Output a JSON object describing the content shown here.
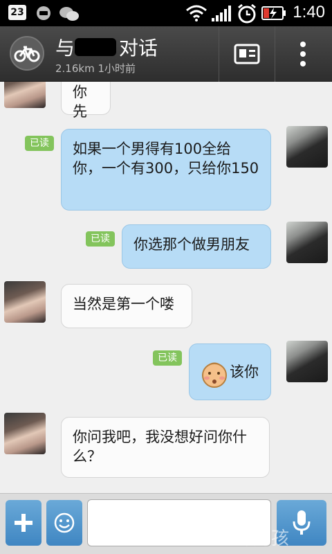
{
  "status_bar": {
    "date": "23",
    "time": "1:40",
    "icons": [
      "calendar-icon",
      "chat-notification-icon",
      "wechat-icon",
      "wifi-icon",
      "signal-icon",
      "alarm-icon",
      "battery-charging-icon"
    ]
  },
  "header": {
    "title": "与",
    "title_tail": "对话",
    "subtitle": "2.16km 1小时前",
    "icons": [
      "bicycle-icon",
      "profile-card-icon",
      "more-vert-icon"
    ]
  },
  "messages": [
    {
      "side": "in",
      "text": "你先"
    },
    {
      "side": "out",
      "text": "如果一个男得有100全给你，一个有300，只给你150",
      "read": "已读"
    },
    {
      "side": "out",
      "text": "你选那个做男朋友",
      "read": "已读"
    },
    {
      "side": "in",
      "text": "当然是第一个喽"
    },
    {
      "side": "out",
      "text": "该你",
      "emoji": "shy-face-emoji",
      "read": "已读"
    },
    {
      "side": "in",
      "text": "你问我吧，我没想好问你什么？"
    }
  ],
  "input_bar": {
    "value": "",
    "icons": [
      "plus-icon",
      "smiley-icon",
      "microphone-icon"
    ],
    "page_indicator": {
      "pages": 2,
      "current": 1
    },
    "watermark": "坏男孩"
  },
  "colors": {
    "out_bubble": "#b7dcf6",
    "in_bubble": "#fbfbfb",
    "read_badge": "#83c45c",
    "accent": "#3f86c2"
  }
}
